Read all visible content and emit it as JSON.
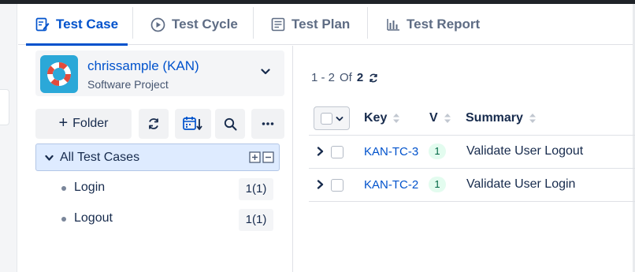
{
  "tabs": [
    {
      "label": "Test Case",
      "icon": "edit-document-icon",
      "active": true
    },
    {
      "label": "Test Cycle",
      "icon": "play-circle-icon",
      "active": false
    },
    {
      "label": "Test Plan",
      "icon": "list-document-icon",
      "active": false
    },
    {
      "label": "Test Report",
      "icon": "bar-chart-icon",
      "active": false
    }
  ],
  "project": {
    "name": "chrissample (KAN)",
    "type": "Software Project",
    "avatar_icon": "lifebuoy-icon"
  },
  "toolbar": {
    "folder_label": "Folder",
    "icons": [
      "plus-icon",
      "refresh-icon",
      "calendar-sort-icon",
      "search-icon",
      "more-icon"
    ]
  },
  "tree": {
    "root_label": "All Test Cases",
    "items": [
      {
        "label": "Login",
        "count": "1(1)"
      },
      {
        "label": "Logout",
        "count": "1(1)"
      }
    ]
  },
  "pagination": {
    "range": "1 - 2",
    "of_label": "Of",
    "total": "2"
  },
  "table": {
    "columns": {
      "key": "Key",
      "version": "V",
      "summary": "Summary"
    },
    "rows": [
      {
        "key": "KAN-TC-3",
        "version": "1",
        "summary": "Validate User Logout"
      },
      {
        "key": "KAN-TC-2",
        "version": "1",
        "summary": "Validate User Login"
      }
    ]
  },
  "colors": {
    "accent": "#0052cc",
    "selected_bg": "#deebff",
    "version_badge_bg": "#e3fcef",
    "avatar_bg": "#2ba8d8"
  }
}
